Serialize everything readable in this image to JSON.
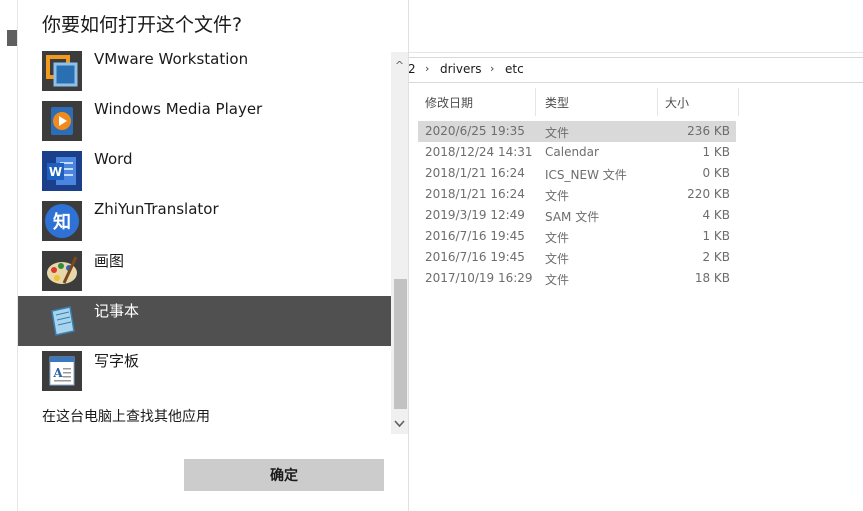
{
  "dialog": {
    "title": "你要如何打开这个文件?",
    "apps": [
      {
        "name": "VMware Workstation",
        "icon": "vmware-icon"
      },
      {
        "name": "Windows Media Player",
        "icon": "media-player-icon"
      },
      {
        "name": "Word",
        "icon": "word-icon"
      },
      {
        "name": "ZhiYunTranslator",
        "icon": "zhiyun-translator-icon"
      },
      {
        "name": "画图",
        "icon": "paint-icon"
      },
      {
        "name": "记事本",
        "icon": "notepad-icon"
      },
      {
        "name": "写字板",
        "icon": "wordpad-icon"
      }
    ],
    "selected_app_index": 5,
    "more_apps_link": "在这台电脑上查找其他应用",
    "ok_button": "确定"
  },
  "explorer": {
    "breadcrumb": [
      "2",
      "drivers",
      "etc"
    ],
    "columns": {
      "date": "修改日期",
      "type": "类型",
      "size": "大小"
    },
    "files": [
      {
        "date": "2020/6/25 19:35",
        "type": "文件",
        "size": "236 KB",
        "selected": true
      },
      {
        "date": "2018/12/24 14:31",
        "type": "Calendar",
        "size": "1 KB"
      },
      {
        "date": "2018/1/21 16:24",
        "type": "ICS_NEW 文件",
        "size": "0 KB"
      },
      {
        "date": "2018/1/21 16:24",
        "type": "文件",
        "size": "220 KB"
      },
      {
        "date": "2019/3/19 12:49",
        "type": "SAM 文件",
        "size": "4 KB"
      },
      {
        "date": "2016/7/16 19:45",
        "type": "文件",
        "size": "1 KB"
      },
      {
        "date": "2016/7/16 19:45",
        "type": "文件",
        "size": "2 KB"
      },
      {
        "date": "2017/10/19 16:29",
        "type": "文件",
        "size": "18 KB"
      }
    ]
  },
  "colors": {
    "selection_dark": "#505050",
    "selection_light": "#d9d9d9",
    "button_bg": "#cccccc",
    "word_blue": "#1e5fbf",
    "zhiyun_blue": "#2f72d6",
    "vmware_orange": "#f29a1f"
  }
}
